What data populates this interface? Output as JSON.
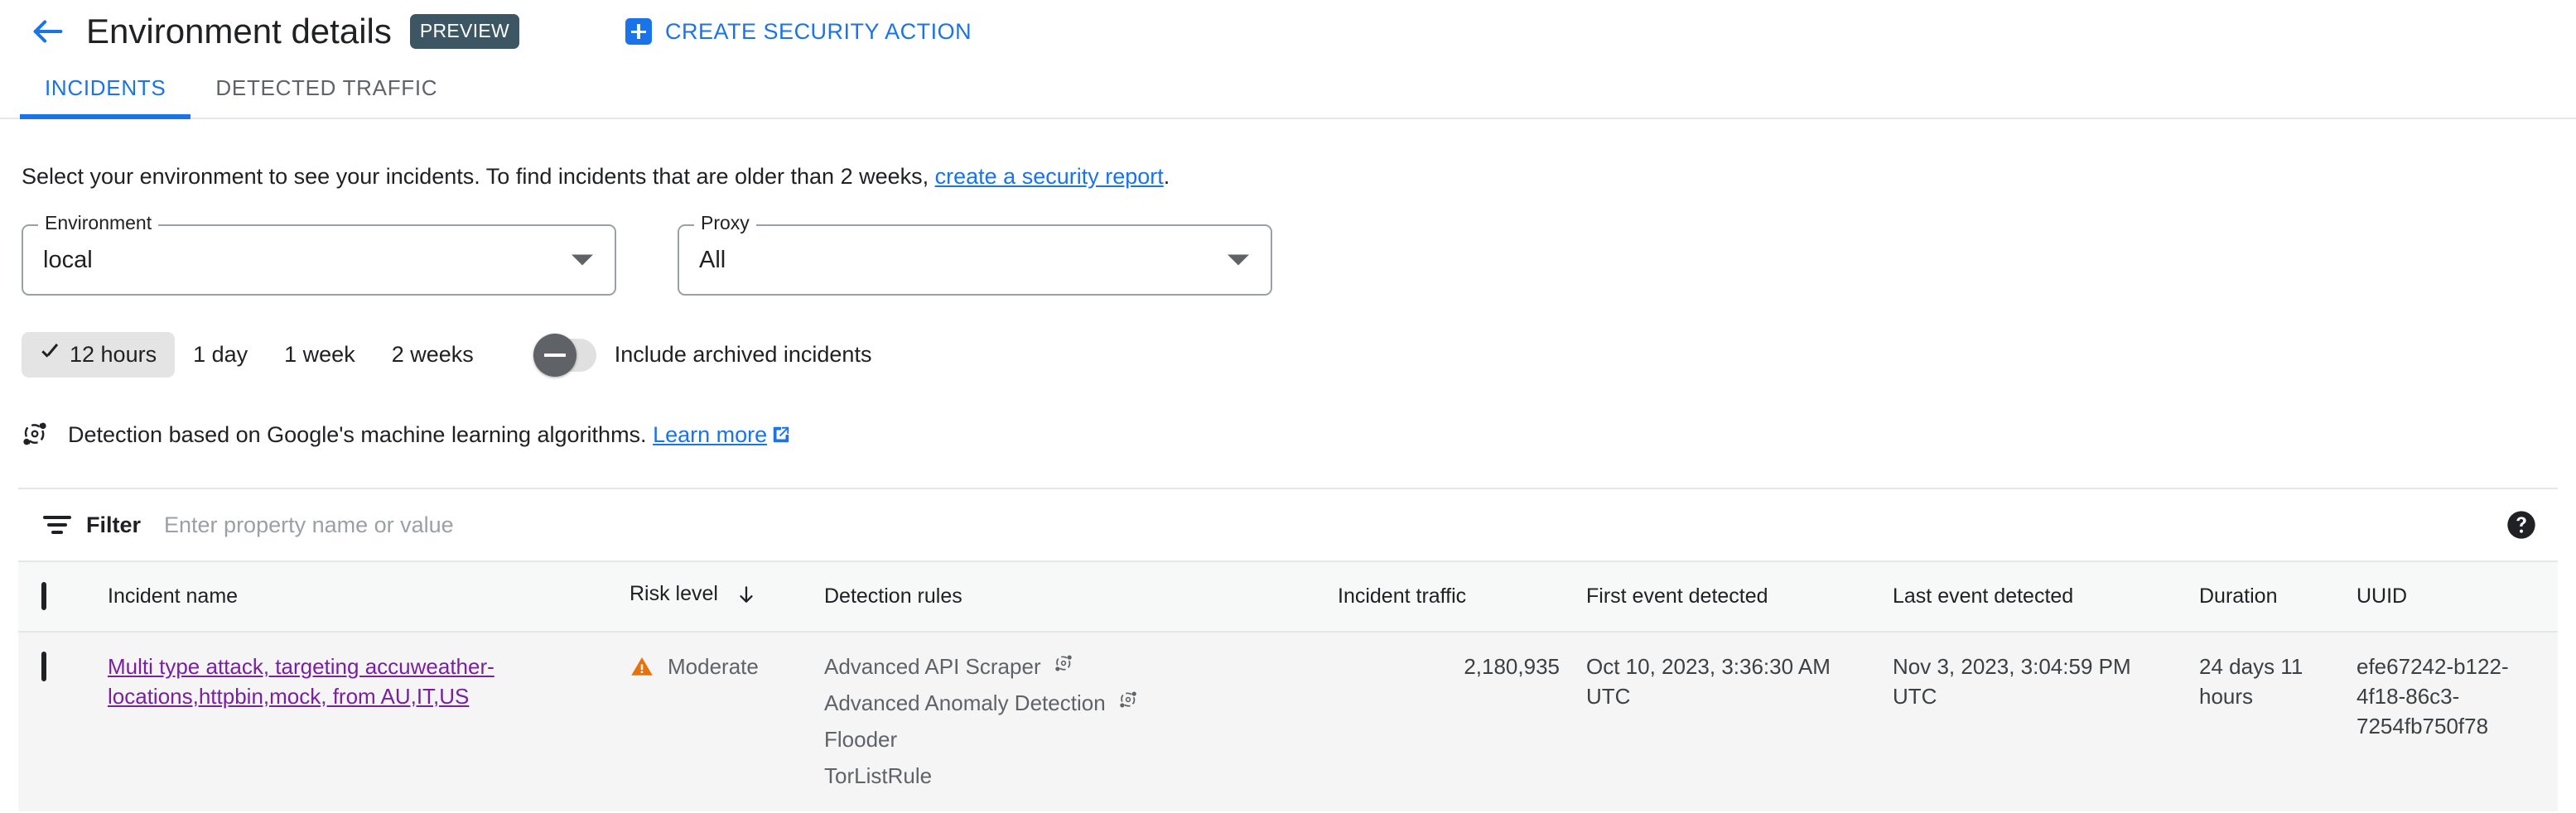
{
  "header": {
    "back_icon": "arrow-left-icon",
    "title": "Environment details",
    "preview_badge": "PREVIEW",
    "create_action_label": "CREATE SECURITY ACTION",
    "create_action_icon": "plus-box-icon",
    "accent_blue": "#1a73e8",
    "preview_badge_bg": "#3c5663"
  },
  "tabs": [
    {
      "label": "INCIDENTS",
      "active": true
    },
    {
      "label": "DETECTED TRAFFIC",
      "active": false
    }
  ],
  "intro": {
    "text_before": "Select your environment to see your incidents. To find incidents that are older than 2 weeks,",
    "link": "create a security report",
    "text_after": "."
  },
  "filters": {
    "environment": {
      "legend": "Environment",
      "value": "local",
      "caret_icon": "chevron-down-icon"
    },
    "proxy": {
      "legend": "Proxy",
      "value": "All",
      "caret_icon": "chevron-down-icon"
    },
    "time_ranges": [
      {
        "label": "12 hours",
        "selected": true
      },
      {
        "label": "1 day",
        "selected": false
      },
      {
        "label": "1 week",
        "selected": false
      },
      {
        "label": "2 weeks",
        "selected": false
      }
    ],
    "archived_toggle": {
      "label": "Include archived incidents",
      "on": false
    }
  },
  "ml_note": {
    "icon": "ml-detection-icon",
    "text": "Detection based on Google's machine learning algorithms.",
    "link": "Learn more",
    "external_icon": "external-link-icon"
  },
  "filter_bar": {
    "icon": "filter-icon",
    "label": "Filter",
    "placeholder": "Enter property name or value",
    "value": "",
    "help_icon": "help-circle-icon"
  },
  "table": {
    "columns": [
      {
        "key": "select",
        "label": ""
      },
      {
        "key": "name",
        "label": "Incident name"
      },
      {
        "key": "risk",
        "label": "Risk level",
        "sort": "desc",
        "sort_icon": "arrow-down-icon"
      },
      {
        "key": "rules",
        "label": "Detection rules"
      },
      {
        "key": "traffic",
        "label": "Incident traffic"
      },
      {
        "key": "first",
        "label": "First event detected"
      },
      {
        "key": "last",
        "label": "Last event detected"
      },
      {
        "key": "duration",
        "label": "Duration"
      },
      {
        "key": "uuid",
        "label": "UUID"
      }
    ],
    "rows": [
      {
        "name": "Multi type attack, targeting accuweather-locations,httpbin,mock, from AU,IT,US",
        "risk": "Moderate",
        "risk_icon": "warning-triangle-icon",
        "risk_color": "#e8710a",
        "rules": [
          {
            "name": "Advanced API Scraper",
            "ml": true
          },
          {
            "name": "Advanced Anomaly Detection",
            "ml": true
          },
          {
            "name": "Flooder",
            "ml": false
          },
          {
            "name": "TorListRule",
            "ml": false
          }
        ],
        "traffic": "2,180,935",
        "first_event": "Oct 10, 2023, 3:36:30 AM UTC",
        "last_event": "Nov 3, 2023, 3:04:59 PM UTC",
        "duration": "24 days 11 hours",
        "uuid": "efe67242-b122-4f18-86c3-7254fb750f78"
      }
    ]
  }
}
